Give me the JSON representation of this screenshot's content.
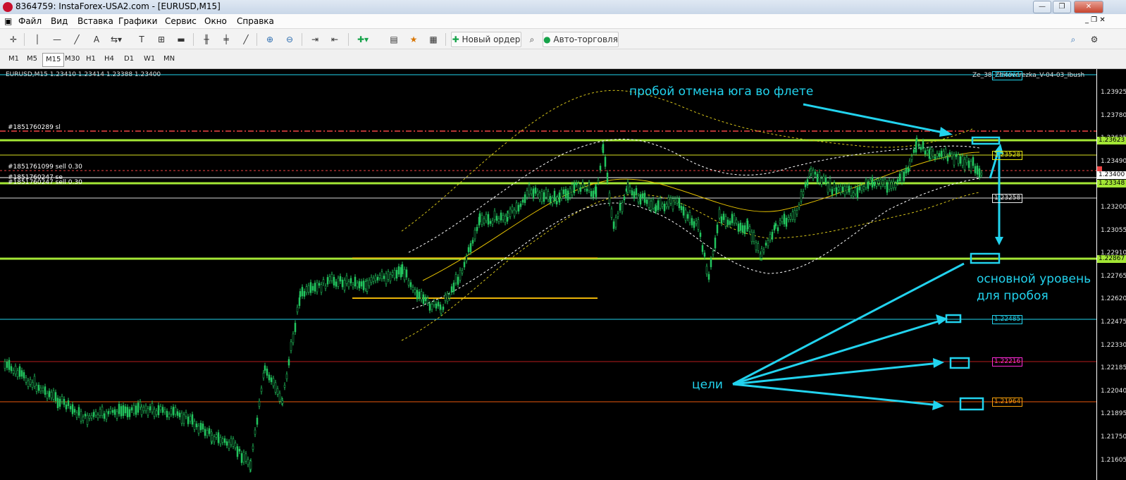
{
  "window": {
    "title": "8364759: InstaForex-USA2.com - [EURUSD,M15]",
    "minimize": "—",
    "maximize": "❐",
    "close": "✕"
  },
  "menu": [
    "Файл",
    "Вид",
    "Вставка",
    "Графики",
    "Сервис",
    "Окно",
    "Справка"
  ],
  "toolbar": {
    "new_order": "Новый ордер",
    "auto_trading": "Авто-торговля",
    "text_tool": "A"
  },
  "timeframes": [
    "M1",
    "M5",
    "M15",
    "M30",
    "H1",
    "H4",
    "D1",
    "W1",
    "MN"
  ],
  "active_timeframe": "M15",
  "chart": {
    "info": "EURUSD,M15  1.23410 1.23414 1.23388 1.23400",
    "indicator": "Ze_38_Zhitoverezka_V-04-03_Ibush",
    "orders": [
      {
        "text": "#1851760289 sl"
      },
      {
        "text": "#1851761099 sell 0.30"
      },
      {
        "text": "#1851760247 se"
      },
      {
        "text": "#1851760247 sell 0.30"
      }
    ],
    "annotations": {
      "breakout": "пробой  отмена юга во флете",
      "main_level_1": "основной уровень",
      "main_level_2": "для пробоя",
      "targets": "цели"
    },
    "price_axis": [
      "1.23925",
      "1.23780",
      "1.23635",
      "1.23490",
      "1.23345",
      "1.23200",
      "1.23055",
      "1.22910",
      "1.22765",
      "1.22620",
      "1.22475",
      "1.22330",
      "1.22185",
      "1.22040",
      "1.21895",
      "1.21750",
      "1.21605"
    ],
    "price_labels": {
      "level_top": "1.23623",
      "current": "1.23400",
      "level_green": "1.23348",
      "main": "1.22867"
    },
    "level_tags": {
      "top": "1.24061",
      "yellow": "1.23528",
      "white": "1.23258",
      "target1": "1.22485",
      "target2": "1.22216",
      "target3": "1.21964"
    },
    "colors": {
      "candles": "#22c55e",
      "level_green": "#a3e635",
      "annotation": "#22d3ee",
      "stop_line": "#ef4444",
      "target2": "#ff2bd6",
      "target3": "#f59e0b"
    }
  }
}
